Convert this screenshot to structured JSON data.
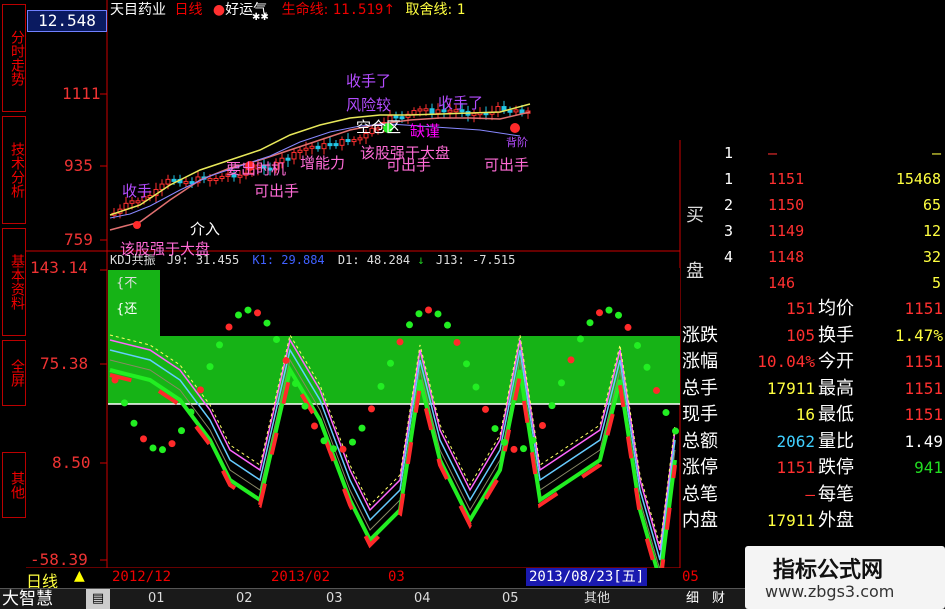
{
  "header": {
    "stock_name": "天目药业",
    "period": "日线",
    "indicator": "好运气",
    "life_line_label": "生命线:",
    "life_line_value": "11.519",
    "life_line_arrow": "↑",
    "take_line_label": "取舍线:",
    "take_line_value": "1",
    "price_box": "12.548"
  },
  "left_tabs": [
    "分时走势",
    "技术分析",
    "基本资料",
    "全屏",
    "其他"
  ],
  "main_axis": [
    "12.548",
    "1111",
    "935",
    "759"
  ],
  "sub_axis": [
    "143.14",
    "75.38",
    "8.50",
    "-58.39"
  ],
  "kdj_header": {
    "name": "KDJ共振",
    "j9": "J9: 31.455",
    "k1": "K1: 29.884",
    "d1": "D1: 48.284",
    "j13": "J13: -7.515",
    "j_more": "-7.5"
  },
  "sub_tags": [
    "{不",
    "{还"
  ],
  "chart_annotations": [
    {
      "text": "收手了",
      "color": "#b44cff"
    },
    {
      "text": "风险较",
      "color": "#b44cff"
    },
    {
      "text": "收手了",
      "color": "#b44cff"
    },
    {
      "text": "空仓区",
      "color": "#ffffff"
    },
    {
      "text": "缺谨",
      "color": "#f0f"
    },
    {
      "text": "该股强于大盘",
      "color": "#ff6bd6"
    },
    {
      "text": "可出手",
      "color": "#ff6bd6"
    },
    {
      "text": "可出手",
      "color": "#ff6bd6"
    },
    {
      "text": "可出手",
      "color": "#ff6bd6"
    },
    {
      "text": "要出时机",
      "color": "#ff6bd6"
    },
    {
      "text": "收手",
      "color": "#b44cff"
    },
    {
      "text": "增能力",
      "color": "#ff6bd6"
    },
    {
      "text": "该股强于大盘",
      "color": "#ff6bd6"
    },
    {
      "text": "介入",
      "color": "#ffffff"
    },
    {
      "text": "背阶",
      "color": "#b44cff"
    }
  ],
  "order_book": {
    "side_label": [
      "买",
      "盘"
    ],
    "rows": [
      {
        "idx": "1",
        "price": "—",
        "vol": "—"
      },
      {
        "idx": "1",
        "price": "1151",
        "vol": "15468"
      },
      {
        "idx": "2",
        "price": "1150",
        "vol": "65"
      },
      {
        "idx": "3",
        "price": "1149",
        "vol": "12"
      },
      {
        "idx": "4",
        "price": "1148",
        "vol": "32"
      },
      {
        "idx": "",
        "price": "146",
        "vol": "5"
      }
    ]
  },
  "stats": [
    {
      "l1": "",
      "v1": "151",
      "l2": "均价",
      "v2": "1151"
    },
    {
      "l1": "涨跌",
      "v1": "105",
      "l2": "换手",
      "v2": "1.47%"
    },
    {
      "l1": "涨幅",
      "v1": "10.04%",
      "l2": "今开",
      "v2": "1151"
    },
    {
      "l1": "总手",
      "v1": "17911",
      "l2": "最高",
      "v2": "1151"
    },
    {
      "l1": "现手",
      "v1": "16",
      "l2": "最低",
      "v2": "1151"
    },
    {
      "l1": "总额",
      "v1": "2062",
      "l2": "量比",
      "v2": "1.49"
    },
    {
      "l1": "涨停",
      "v1": "1151",
      "l2": "跌停",
      "v2": "941"
    },
    {
      "l1": "总笔",
      "v1": "—",
      "l2": "每笔",
      "v2": ""
    },
    {
      "l1": "内盘",
      "v1": "17911",
      "l2": "外盘",
      "v2": ""
    }
  ],
  "time_axis": {
    "period_label": "日线",
    "labels": [
      "2012/12",
      "2013/02",
      "03",
      "05"
    ],
    "current_date": "2013/08/23[五]"
  },
  "bottom_bar": {
    "brand": "大智慧",
    "tabs": [
      "01",
      "02",
      "03",
      "04",
      "05",
      "其他"
    ],
    "right_tabs": [
      "细",
      "财"
    ]
  },
  "watermark": {
    "title": "指标公式网",
    "url": "www.zbgs3.com"
  },
  "colors": {
    "up": "#ff2a2a",
    "down": "#22c6e6",
    "green": "#22cc22",
    "axis": "#cc0000"
  }
}
